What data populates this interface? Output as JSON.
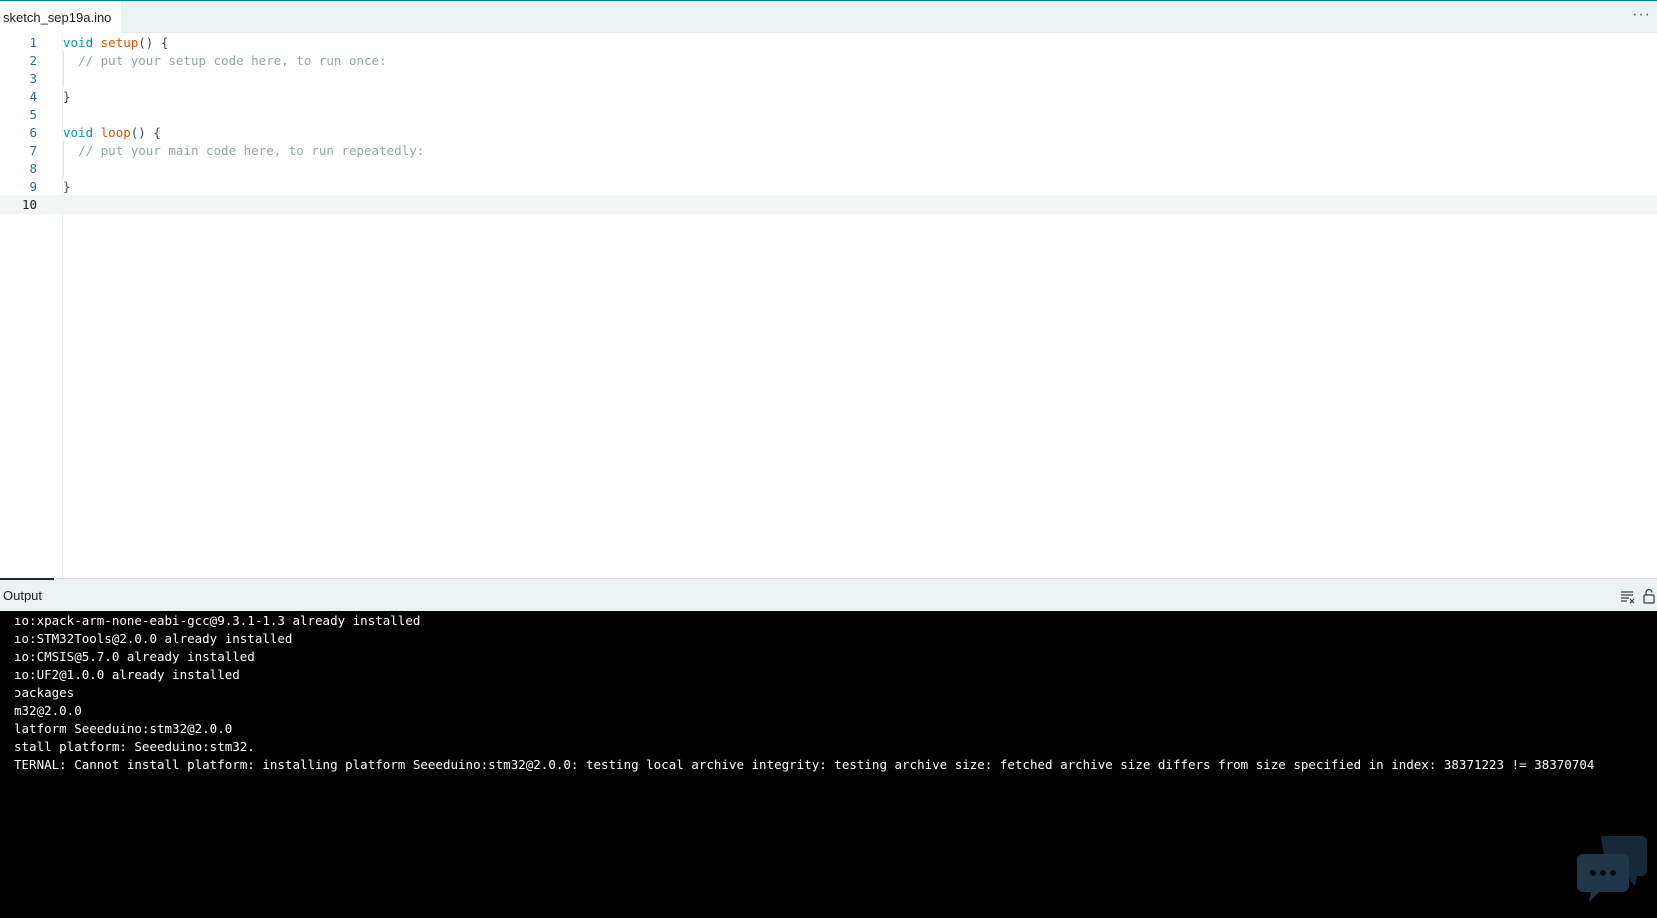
{
  "tab": {
    "filename": "sketch_sep19a.ino"
  },
  "editor": {
    "lines": [
      {
        "num": "1",
        "parts": [
          {
            "t": "void",
            "c": "kw"
          },
          {
            "t": " "
          },
          {
            "t": "setup",
            "c": "fn"
          },
          {
            "t": "() {"
          }
        ]
      },
      {
        "num": "2",
        "parts": [
          {
            "t": "  "
          },
          {
            "t": "// put your setup code here, to run once:",
            "c": "cm"
          }
        ]
      },
      {
        "num": "3",
        "parts": []
      },
      {
        "num": "4",
        "parts": [
          {
            "t": "}"
          }
        ]
      },
      {
        "num": "5",
        "parts": []
      },
      {
        "num": "6",
        "parts": [
          {
            "t": "void",
            "c": "kw"
          },
          {
            "t": " "
          },
          {
            "t": "loop",
            "c": "fn"
          },
          {
            "t": "() {"
          }
        ]
      },
      {
        "num": "7",
        "parts": [
          {
            "t": "  "
          },
          {
            "t": "// put your main code here, to run repeatedly:",
            "c": "cm"
          }
        ]
      },
      {
        "num": "8",
        "parts": []
      },
      {
        "num": "9",
        "parts": [
          {
            "t": "}"
          }
        ]
      },
      {
        "num": "10",
        "parts": [],
        "active": true
      }
    ]
  },
  "output": {
    "title": "Output",
    "lines": [
      "ıo:xpack-arm-none-eabi-gcc@9.3.1-1.3 already installed",
      "ıo:STM32Tools@2.0.0 already installed",
      "ıo:CMSIS@5.7.0 already installed",
      "ıo:UF2@1.0.0 already installed",
      "ɔackages",
      "m32@2.0.0",
      "latform Seeeduino:stm32@2.0.0",
      "stall platform: Seeeduino:stm32.",
      "TERNAL: Cannot install platform: installing platform Seeeduino:stm32@2.0.0: testing local archive integrity: testing archive size: fetched archive size differs from size specified in index: 38371223 != 38370704"
    ]
  },
  "icons": {
    "more": "more-dots-icon",
    "clear": "clear-output-icon",
    "lock": "scroll-lock-icon"
  }
}
